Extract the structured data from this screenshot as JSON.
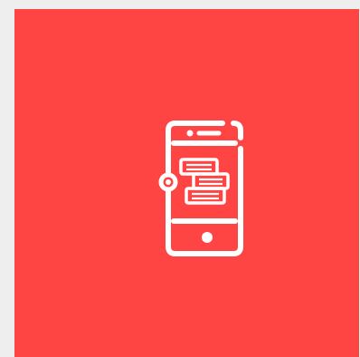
{
  "colors": {
    "background": "#eeeeee",
    "tile": "#ff4444",
    "icon": "#ffffff"
  },
  "icon": {
    "name": "mobile-library-books-icon"
  }
}
